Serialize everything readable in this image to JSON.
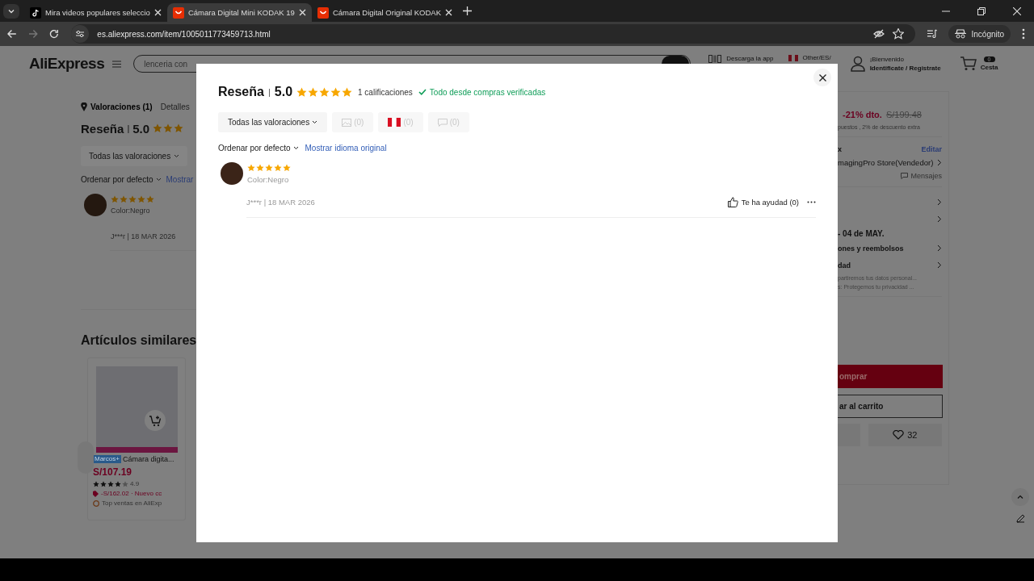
{
  "browser": {
    "tabs": [
      {
        "kind": "video",
        "title": "Mira videos populares seleccio",
        "selected": false
      },
      {
        "kind": "shop",
        "title": "Cámara Digital Mini KODAK 19",
        "selected": true
      },
      {
        "kind": "shop",
        "title": "Cámara Digital Original KODAK",
        "selected": false
      }
    ],
    "address": "es.aliexpress.com/item/1005011773459713.html",
    "profile_label": "Incógnito"
  },
  "page": {
    "header": {
      "logo": "AliExpress",
      "search_placeholder": "lenceria con",
      "app_label": "Descarga la app",
      "region": "Other/ES/",
      "greeting": "¡Bienvenido",
      "account": "Identificate / Registrate",
      "cart_count": "0",
      "cart_label": "Cesta"
    },
    "left": {
      "nav": [
        {
          "label": "Valoraciones (1)",
          "selected": true
        },
        {
          "label": "Detalles",
          "selected": false
        }
      ],
      "review_title": "Reseña",
      "separator": "|",
      "review_score": "5.0",
      "stars": 3,
      "filter_label": "Todas las valoraciones",
      "sort_label": "Ordenar por defecto",
      "translate_link": "Mostrar",
      "review": {
        "stars": 5,
        "variant": "Color:Negro",
        "byline": "J***r | 18 MAR 2026"
      },
      "similar_title": "Artículos similares",
      "product": {
        "badge": "Marcos+",
        "name": "Cámara digita...",
        "price": "S/107.19",
        "stars": 4,
        "rating": "4.9",
        "discount": "-S/162.02 · Nuevo cc",
        "tag": "Top ventas en AliExp"
      }
    },
    "right": {
      "discount": "-21% dto.",
      "original_price": "S/199.48",
      "price_note": "puestos , 2% de descuento extra",
      "ship_label": "x",
      "ship_action": "Editar",
      "store": "magingPro Store(Vendedor)",
      "messages": "Mensajes",
      "rows": [
        {
          "kind": "link"
        },
        {
          "kind": "link"
        },
        {
          "kind": "text",
          "label": "- 04 de MAY."
        },
        {
          "kind": "link",
          "label": "ones y reembolsos"
        },
        {
          "kind": "link",
          "label": "dad"
        }
      ],
      "privacy_notes": [
        "partiremos tus datos personal...",
        "s: Protegemos tu privacidad ..."
      ],
      "buy_label": "omprar",
      "cart_label": "ar al carrito",
      "wishlist_count": "32"
    }
  },
  "modal": {
    "title": "Reseña",
    "separator": "|",
    "score": "5.0",
    "stars": 5,
    "count": "1 calificaciones",
    "verified": "Todo desde compras verificadas",
    "filters": [
      {
        "kind": "all",
        "label": "Todas las valoraciones",
        "disabled": false
      },
      {
        "kind": "photo",
        "label": "(0)",
        "disabled": true
      },
      {
        "kind": "country",
        "label": "(0)",
        "disabled": true
      },
      {
        "kind": "comment",
        "label": "(0)",
        "disabled": true
      }
    ],
    "sort_label": "Ordenar por defecto",
    "translate_link": "Mostrar idioma original",
    "reviews": [
      {
        "stars": 5,
        "variant": "Color:Negro",
        "byline": "J***r | 18 MAR 2026",
        "helpful": "Te ha ayudad (0)"
      }
    ]
  }
}
